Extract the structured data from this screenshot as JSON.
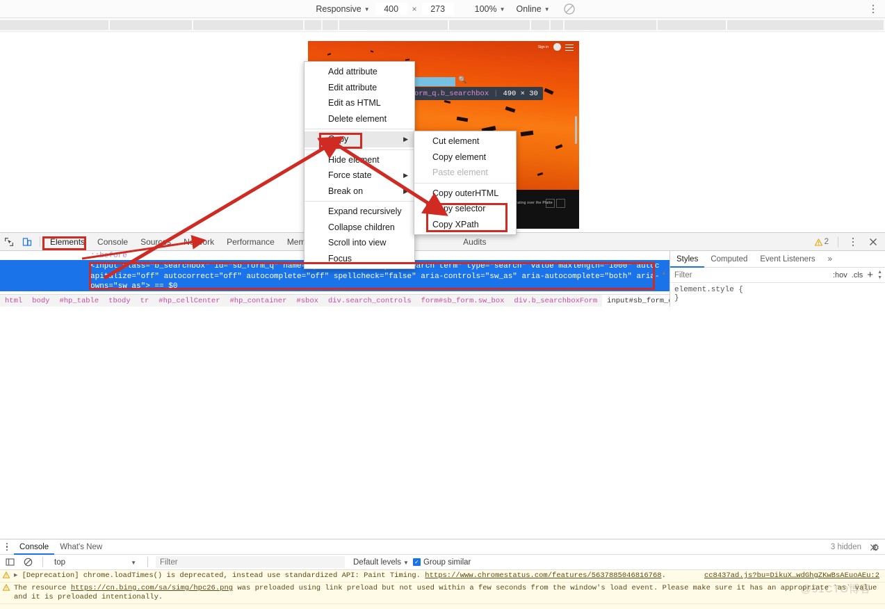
{
  "device_toolbar": {
    "device": "Responsive",
    "width": "400",
    "height": "273",
    "x_label": "×",
    "zoom": "100%",
    "throttle": "Online",
    "clear_icon": "no-throttling-icon",
    "kebab_icon": "more-options-icon"
  },
  "viewport": {
    "element_tooltip": {
      "selector": "input#sb_form_q.b_searchbox",
      "divider": "|",
      "size": "490 × 30"
    },
    "signin_label": "Sign in",
    "hero_caption": "Sandhill cranes migrating over the Platte",
    "search_icon": "magnifier-icon",
    "hamburger_icon": "hamburger-menu-icon",
    "resize_grip_icon": "resize-grip-icon"
  },
  "context_menu": {
    "items": [
      {
        "label": "Add attribute",
        "submenu": false,
        "sep_after": false
      },
      {
        "label": "Edit attribute",
        "submenu": false,
        "sep_after": false
      },
      {
        "label": "Edit as HTML",
        "submenu": false,
        "sep_after": false
      },
      {
        "label": "Delete element",
        "submenu": false,
        "sep_after": true
      },
      {
        "label": "Copy",
        "submenu": true,
        "sep_after": true
      },
      {
        "label": "Hide element",
        "submenu": false,
        "sep_after": false
      },
      {
        "label": "Force state",
        "submenu": true,
        "sep_after": false
      },
      {
        "label": "Break on",
        "submenu": true,
        "sep_after": true
      },
      {
        "label": "Expand recursively",
        "submenu": false,
        "sep_after": false
      },
      {
        "label": "Collapse children",
        "submenu": false,
        "sep_after": false
      },
      {
        "label": "Scroll into view",
        "submenu": false,
        "sep_after": false
      },
      {
        "label": "Focus",
        "submenu": false,
        "sep_after": false
      }
    ],
    "highlighted": "Copy",
    "submenu_arrow": "▶"
  },
  "copy_submenu": {
    "items": [
      {
        "label": "Cut element",
        "disabled": false,
        "sep_after": false
      },
      {
        "label": "Copy element",
        "disabled": false,
        "sep_after": false
      },
      {
        "label": "Paste element",
        "disabled": true,
        "sep_after": true
      },
      {
        "label": "Copy outerHTML",
        "disabled": false,
        "sep_after": false
      },
      {
        "label": "Copy selector",
        "disabled": false,
        "sep_after": false
      },
      {
        "label": "Copy XPath",
        "disabled": false,
        "sep_after": false
      }
    ]
  },
  "devtools": {
    "inspect_icon": "inspect-element-icon",
    "device_toggle_icon": "toggle-device-toolbar-icon",
    "tabs": [
      {
        "label": "Elements",
        "active": true
      },
      {
        "label": "Console",
        "active": false
      },
      {
        "label": "Sources",
        "active": false
      },
      {
        "label": "Network",
        "active": false
      },
      {
        "label": "Performance",
        "active": false
      },
      {
        "label": "Memory",
        "active": false
      },
      {
        "label": "Audits",
        "active": false
      }
    ],
    "warning_count": "2",
    "warning_icon": "warning-triangle-icon",
    "kebab_icon": "more-tools-icon",
    "close_icon": "close-devtools-icon"
  },
  "elements_tree": {
    "pseudo_before": "::before",
    "selected_node": "<input class=\"b_searchbox\" id=\"sb_form_q\" name=\"q\" title=\"Enter your search term\" type=\"search\" value maxlength=\"1000\" autocapitalize=\"off\" autocorrect=\"off\" autocomplete=\"off\" spellcheck=\"false\" aria-controls=\"sw_as\" aria-autocomplete=\"both\" aria-owns=\"sw_as\"> == $0"
  },
  "breadcrumb": {
    "crumbs": [
      "html",
      "body",
      "#hp_table",
      "tbody",
      "tr",
      "#hp_cellCenter",
      "#hp_container",
      "#sbox",
      "div.search_controls",
      "form#sb_form.sw_box",
      "div.b_searchboxForm",
      "input#sb_form_q.b_searchbox"
    ]
  },
  "styles_pane": {
    "tabs": [
      {
        "label": "Styles",
        "active": true
      },
      {
        "label": "Computed",
        "active": false
      },
      {
        "label": "Event Listeners",
        "active": false
      }
    ],
    "overflow": "»",
    "filter_placeholder": "Filter",
    "hov_label": ":hov",
    "cls_label": ".cls",
    "add_rule_icon": "add-style-rule-icon",
    "element_style_rule": "element.style {\n}"
  },
  "drawer": {
    "kebab_icon": "drawer-more-icon",
    "tabs": [
      {
        "label": "Console",
        "active": true
      },
      {
        "label": "What's New",
        "active": false
      }
    ],
    "close_icon": "close-drawer-icon",
    "sidebar_icon": "console-sidebar-icon",
    "clear_icon": "clear-console-icon",
    "context": "top",
    "filter_placeholder": "Filter",
    "levels": "Default levels",
    "group_similar": "Group similar",
    "group_similar_checked": true,
    "hidden_count": "3 hidden",
    "settings_icon": "console-settings-icon"
  },
  "console_messages": [
    {
      "icon": "warning-triangle-icon",
      "expander": "▸",
      "text_before": "[Deprecation] chrome.loadTimes() is deprecated, instead use standardized API: Paint Timing. ",
      "link": "https://www.chromestatus.com/features/5637885046816768",
      "text_after": ".",
      "source": "cc8437ad.js?bu=DikuX…wdGhgZKwBsAEuoAEu:2"
    },
    {
      "icon": "warning-triangle-icon",
      "expander": "",
      "text_before": "The resource ",
      "link": "https://cn.bing.com/sa/simg/hpc26.png",
      "text_after": " was preloaded using link preload but not used within a few seconds from the window's load event. Please make sure it has an appropriate `as` value and it is preloaded intentionally.",
      "source": ""
    }
  ],
  "watermark": "@51CTO博客",
  "colors": {
    "accent": "#1a73e8",
    "annotation_red": "#cf2b23",
    "warning_yellow": "#fffbe6",
    "tooltip_bg": "#333d4a"
  }
}
